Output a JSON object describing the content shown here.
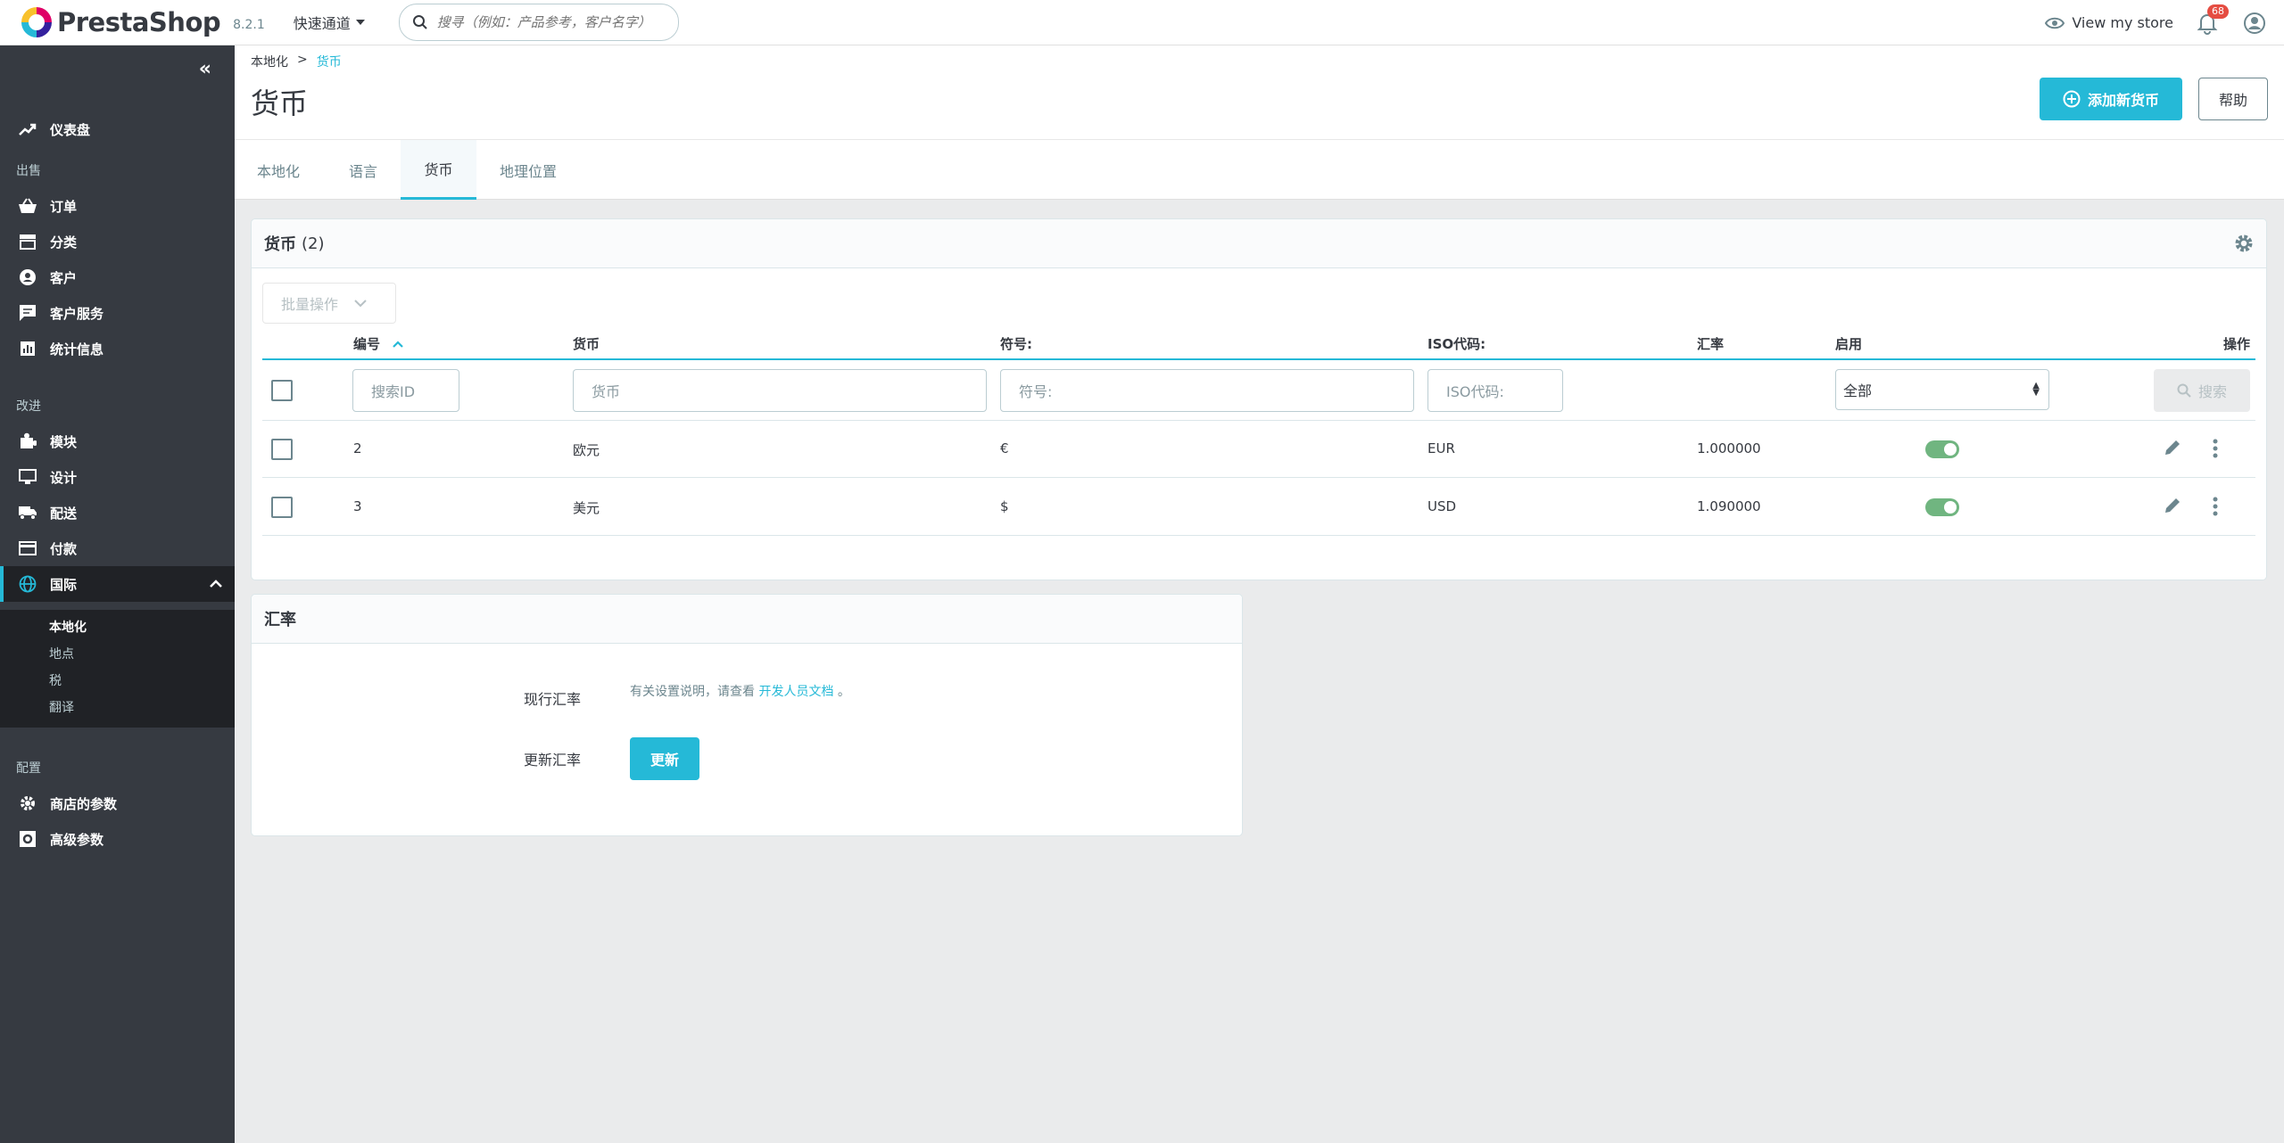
{
  "header": {
    "logo_text": "PrestaShop",
    "version": "8.2.1",
    "quick_access": "快速通道",
    "search_placeholder": "搜寻（例如：产品参考，客户名字）",
    "view_store": "View my store",
    "notification_count": "68"
  },
  "sidebar": {
    "dashboard": "仪表盘",
    "section_sell": "出售",
    "orders": "订单",
    "catalog": "分类",
    "customers": "客户",
    "customer_service": "客户服务",
    "stats": "统计信息",
    "section_improve": "改进",
    "modules": "模块",
    "design": "设计",
    "shipping": "配送",
    "payment": "付款",
    "international": "国际",
    "sub": {
      "localization": "本地化",
      "locations": "地点",
      "taxes": "税",
      "translations": "翻译"
    },
    "section_configure": "配置",
    "shop_params": "商店的参数",
    "advanced_params": "高级参数"
  },
  "page": {
    "breadcrumb_parent": "本地化",
    "breadcrumb_sep": ">",
    "breadcrumb_current": "货币",
    "title": "货币",
    "add_button": "添加新货币",
    "help_button": "帮助"
  },
  "tabs": [
    "本地化",
    "语言",
    "货币",
    "地理位置"
  ],
  "currencies_card": {
    "title": "货币",
    "count": "(2)",
    "bulk_actions": "批量操作",
    "columns": {
      "id": "编号",
      "currency": "货币",
      "symbol": "符号:",
      "iso": "ISO代码:",
      "rate": "汇率",
      "enabled": "启用",
      "actions": "操作"
    },
    "filters": {
      "id_placeholder": "搜索ID",
      "currency_placeholder": "货币",
      "symbol_placeholder": "符号:",
      "iso_placeholder": "ISO代码:",
      "enabled_value": "全部",
      "search_button": "搜索"
    },
    "rows": [
      {
        "id": "2",
        "currency": "欧元",
        "symbol": "€",
        "iso": "EUR",
        "rate": "1.000000",
        "enabled": true
      },
      {
        "id": "3",
        "currency": "美元",
        "symbol": "$",
        "iso": "USD",
        "rate": "1.090000",
        "enabled": true
      }
    ]
  },
  "rates_card": {
    "title": "汇率",
    "live_rates_label": "现行汇率",
    "help_prefix": "有关设置说明，请查看",
    "help_link": "开发人员文档",
    "help_suffix": "。",
    "update_label": "更新汇率",
    "update_button": "更新"
  },
  "colors": {
    "primary": "#25b9d7",
    "sidebar": "#363a41",
    "toggle_on": "#70b580"
  }
}
